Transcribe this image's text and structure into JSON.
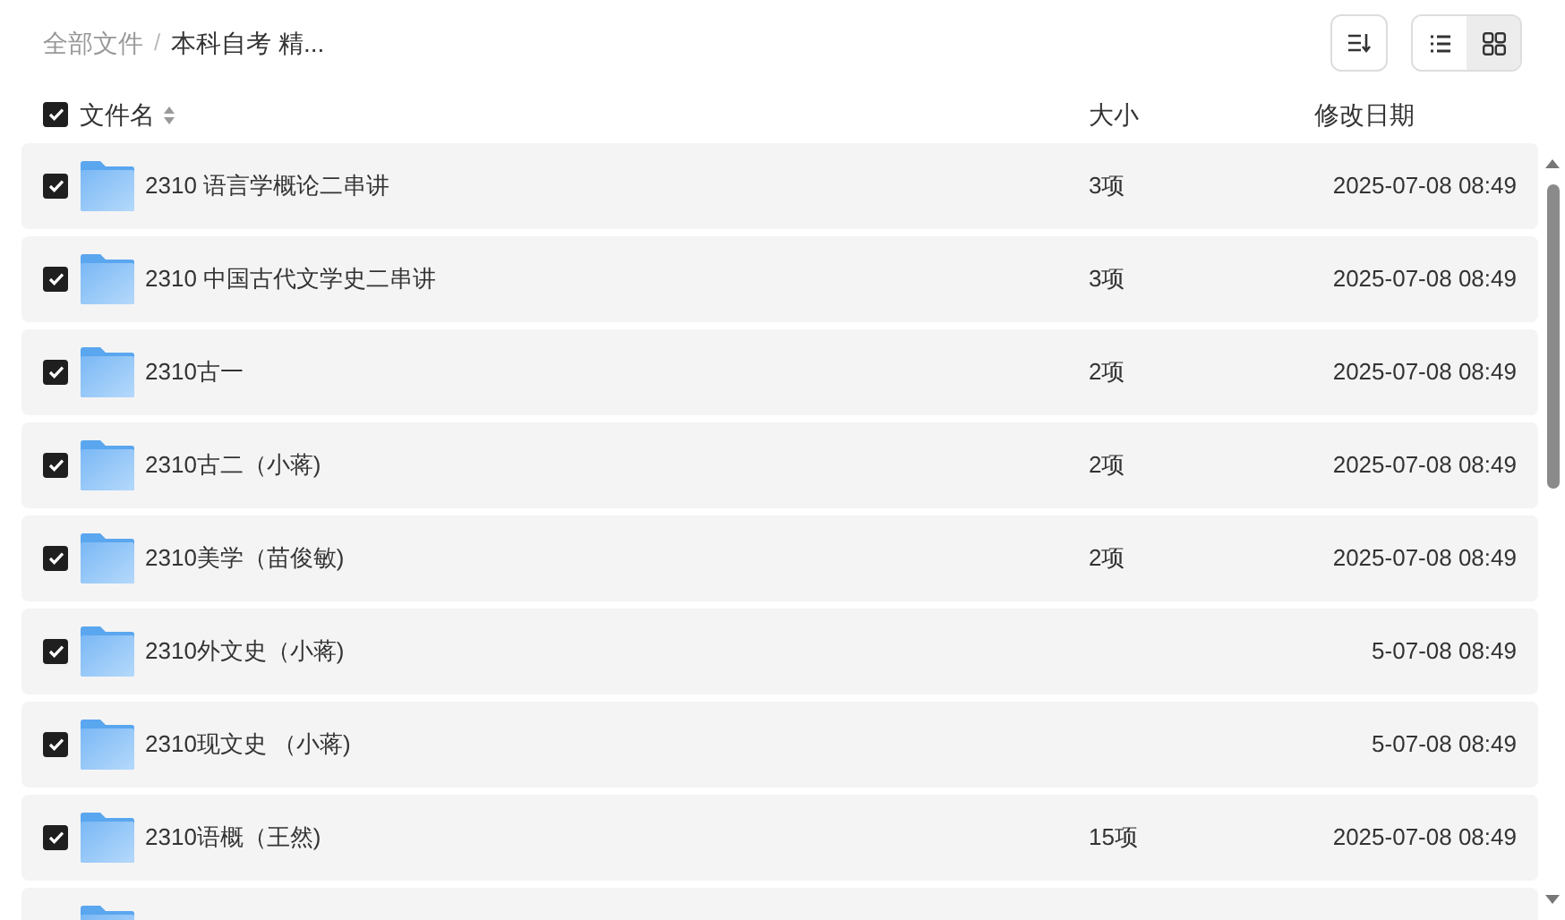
{
  "breadcrumb": [
    {
      "label": "全部文件",
      "current": false
    },
    {
      "label": "本科自考 精...",
      "current": true
    }
  ],
  "breadcrumb_separator": "/",
  "toolbar": {
    "views": [
      {
        "kind": "list",
        "selected": false
      },
      {
        "kind": "grid",
        "selected": true
      }
    ]
  },
  "header": {
    "checked": true,
    "columns": [
      "文件名",
      "大小",
      "修改日期"
    ]
  },
  "rows": [
    {
      "name": "2310 语言学概论二串讲",
      "size": "3项",
      "date": "2025-07-08 08:49",
      "checked": true
    },
    {
      "name": "2310 中国古代文学史二串讲",
      "size": "3项",
      "date": "2025-07-08 08:49",
      "checked": true
    },
    {
      "name": "2310古一",
      "size": "2项",
      "date": "2025-07-08 08:49",
      "checked": true
    },
    {
      "name": "2310古二（小蒋)",
      "size": "2项",
      "date": "2025-07-08 08:49",
      "checked": true
    },
    {
      "name": "2310美学（苗俊敏)",
      "size": "2项",
      "date": "2025-07-08 08:49",
      "checked": true
    },
    {
      "name": "2310外文史（小蒋)",
      "date": "5-07-08 08:49",
      "checked": true
    },
    {
      "name": "2310现文史 （小蒋)",
      "date": "5-07-08 08:49",
      "checked": true
    },
    {
      "name": "2310语概（王然)",
      "size": "15项",
      "date": "2025-07-08 08:49",
      "checked": true
    },
    {
      "kind": "cut-off"
    }
  ]
}
